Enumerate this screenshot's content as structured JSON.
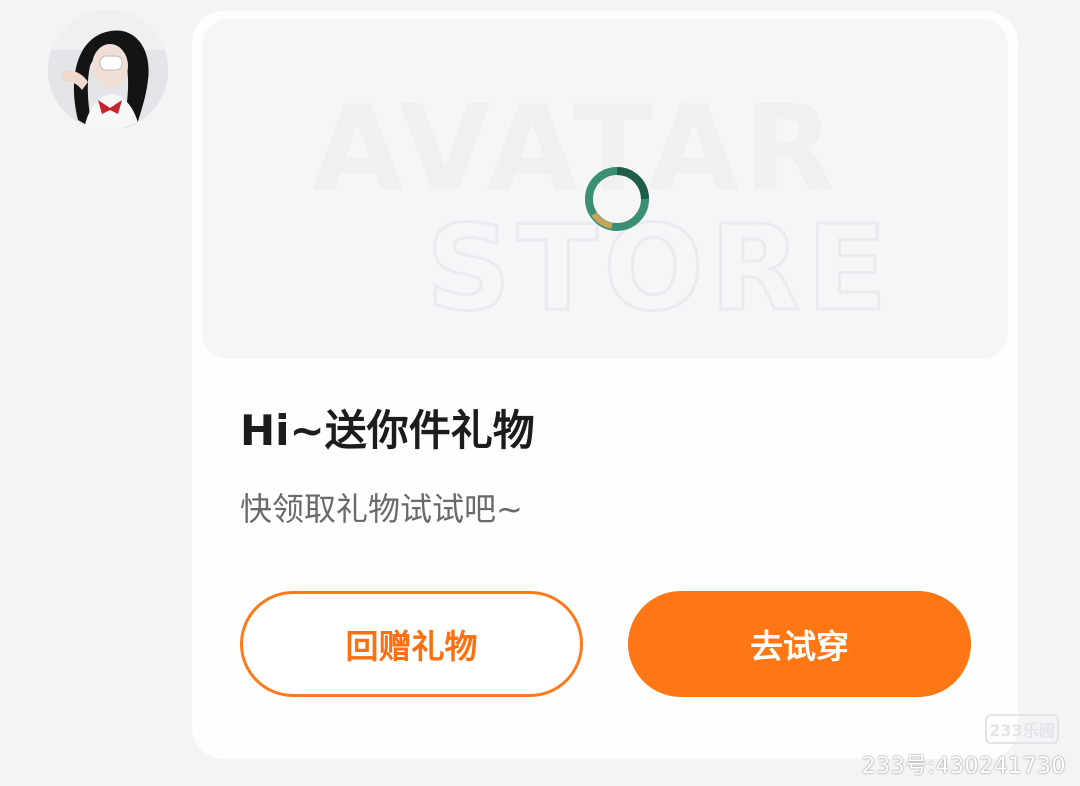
{
  "preview": {
    "background_text_line1": "AVATAR",
    "background_text_line2": "STORE"
  },
  "gift": {
    "title": "Hi~送你件礼物",
    "subtitle": "快领取礼物试试吧~",
    "return_gift_label": "回赠礼物",
    "try_on_label": "去试穿"
  },
  "watermark": {
    "logo_text": "233乐园",
    "id_text": "233号:430241730"
  },
  "colors": {
    "accent": "#ff7614",
    "title": "#1c1c1c",
    "subtitle": "#6a6a6a",
    "background": "#f4f4f7"
  }
}
